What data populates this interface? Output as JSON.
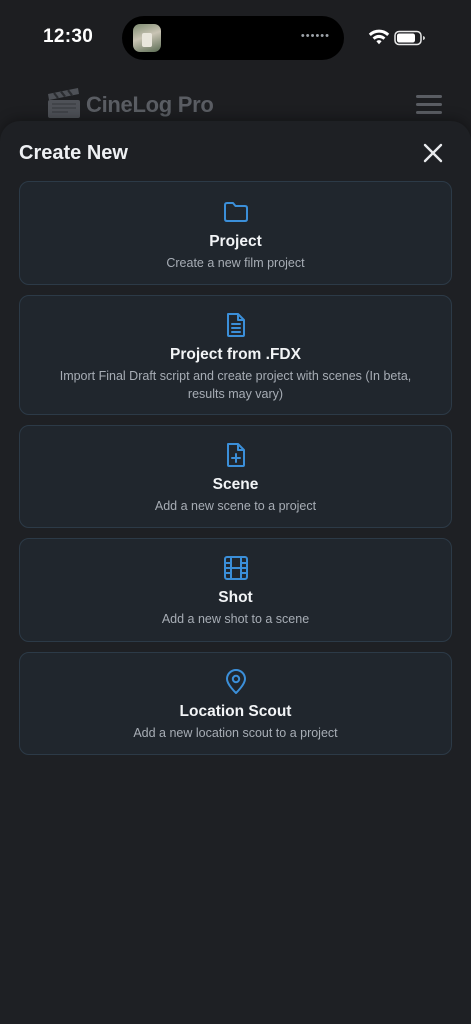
{
  "status_bar": {
    "time": "12:30",
    "island_dots": "••••••"
  },
  "app": {
    "name": "CineLog Pro"
  },
  "sheet": {
    "title": "Create New",
    "options": [
      {
        "title": "Project",
        "description": "Create a new film project",
        "icon": "folder-icon"
      },
      {
        "title": "Project from .FDX",
        "description": "Import Final Draft script and create project with scenes (In beta, results may vary)",
        "icon": "document-icon"
      },
      {
        "title": "Scene",
        "description": "Add a new scene to a project",
        "icon": "file-plus-icon"
      },
      {
        "title": "Shot",
        "description": "Add a new shot to a scene",
        "icon": "film-icon"
      },
      {
        "title": "Location Scout",
        "description": "Add a new location scout to a project",
        "icon": "map-pin-icon"
      }
    ]
  },
  "colors": {
    "accent": "#3b8fd9",
    "background": "#1d1e21",
    "card": "#20262d",
    "card_border": "#2c3a47"
  }
}
